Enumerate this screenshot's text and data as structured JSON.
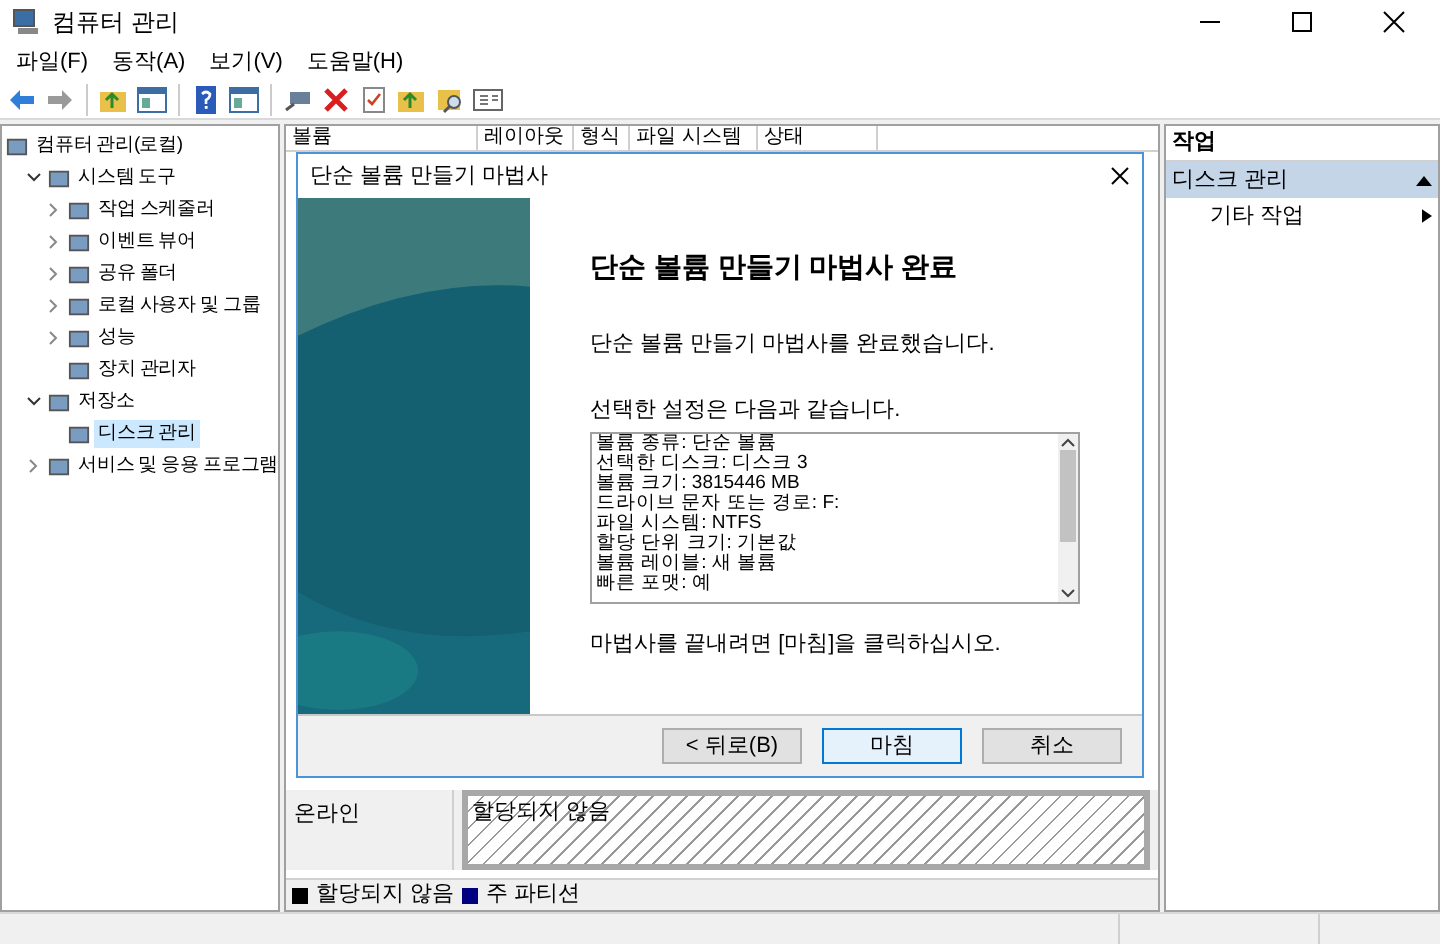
{
  "window": {
    "title": "컴퓨터 관리"
  },
  "menu": [
    "파일(F)",
    "동작(A)",
    "보기(V)",
    "도움말(H)"
  ],
  "toolbar": [
    {
      "kind": "back"
    },
    {
      "kind": "forward"
    },
    {
      "kind": "sep"
    },
    {
      "kind": "folder-up"
    },
    {
      "kind": "pane"
    },
    {
      "kind": "sep"
    },
    {
      "kind": "help"
    },
    {
      "kind": "pane"
    },
    {
      "kind": "sep"
    },
    {
      "kind": "connect"
    },
    {
      "kind": "delete"
    },
    {
      "kind": "properties"
    },
    {
      "kind": "folder-up"
    },
    {
      "kind": "search"
    },
    {
      "kind": "console"
    }
  ],
  "tree": [
    {
      "label": "컴퓨터 관리(로컬)",
      "selected": false,
      "children": [
        {
          "label": "시스템 도구",
          "expanded": true,
          "selected": false,
          "children": [
            {
              "label": "작업 스케줄러",
              "expanded": false,
              "selected": false
            },
            {
              "label": "이벤트 뷰어",
              "expanded": false,
              "selected": false
            },
            {
              "label": "공유 폴더",
              "expanded": false,
              "selected": false
            },
            {
              "label": "로컬 사용자 및 그룹",
              "expanded": false,
              "selected": false
            },
            {
              "label": "성능",
              "expanded": false,
              "selected": false
            },
            {
              "label": "장치 관리자",
              "selected": false
            }
          ]
        },
        {
          "label": "저장소",
          "expanded": true,
          "selected": false,
          "children": [
            {
              "label": "디스크 관리",
              "selected": true
            }
          ]
        },
        {
          "label": "서비스 및 응용 프로그램",
          "expanded": false,
          "selected": false
        }
      ]
    }
  ],
  "volume_table": {
    "columns": [
      "볼륨",
      "레이아웃",
      "형식",
      "파일 시스템",
      "상태"
    ]
  },
  "disk_map": {
    "status": "온라인",
    "partition": "할당되지 않음"
  },
  "legend": [
    {
      "label": "할당되지 않음",
      "color": "#000000"
    },
    {
      "label": "주 파티션",
      "color": "#000080"
    }
  ],
  "actions": {
    "header": "작업",
    "section": {
      "label": "디스크 관리",
      "expanded": true
    },
    "items": [
      "기타 작업"
    ]
  },
  "dialog": {
    "title": "단순 볼륨 만들기 마법사",
    "heading": "단순 볼륨 만들기 마법사 완료",
    "message": "단순 볼륨 만들기 마법사를 완료했습니다.",
    "settings_label": "선택한 설정은 다음과 같습니다.",
    "settings": [
      "볼륨 종류: 단순 볼륨",
      "선택한 디스크: 디스크 3",
      "볼륨 크기: 3815446 MB",
      "드라이브 문자 또는 경로: F:",
      "파일 시스템: NTFS",
      "할당 단위 크기: 기본값",
      "볼륨 레이블: 새 볼륨",
      "빠른 포맷: 예"
    ],
    "finish_hint": "마법사를 끝내려면 [마침]을 클릭하십시오.",
    "buttons": [
      {
        "label": "< 뒤로(B)",
        "selected": false
      },
      {
        "label": "마침",
        "selected": true
      },
      {
        "label": "취소",
        "selected": false
      }
    ]
  }
}
